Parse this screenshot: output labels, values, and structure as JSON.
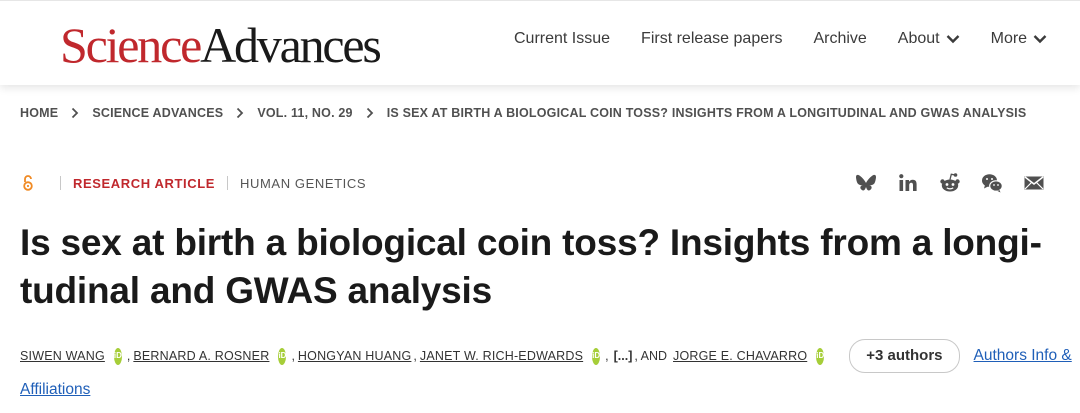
{
  "header": {
    "logo_science": "Science",
    "logo_advances": "Advances",
    "nav": [
      {
        "label": "Current Issue",
        "dropdown": false
      },
      {
        "label": "First release papers",
        "dropdown": false
      },
      {
        "label": "Archive",
        "dropdown": false
      },
      {
        "label": "About",
        "dropdown": true
      },
      {
        "label": "More",
        "dropdown": true
      }
    ]
  },
  "breadcrumb": [
    "HOME",
    "SCIENCE ADVANCES",
    "VOL. 11, NO. 29",
    "IS SEX AT BIRTH A BIOLOGICAL COIN TOSS? INSIGHTS FROM A LONGITUDINAL AND GWAS ANALYSIS"
  ],
  "article": {
    "open_access_icon": "open-access-icon",
    "type": "RESEARCH ARTICLE",
    "subject": "HUMAN GENETICS",
    "title": "Is sex at birth a biological coin toss? Insights from a longi-tudinal and GWAS analysis",
    "share_icons": [
      "bluesky-icon",
      "linkedin-icon",
      "reddit-icon",
      "wechat-icon",
      "email-icon"
    ]
  },
  "authors": {
    "list": [
      "SIWEN WANG",
      "BERNARD A. ROSNER",
      "HONGYAN HUANG",
      "JANET W. RICH-EDWARDS",
      "JORGE E. CHAVARRO"
    ],
    "orcid_label": "iD",
    "ellipsis": "[...]",
    "and_text": ", AND",
    "more_button": "+3 authors",
    "info_link_line1": "Authors Info &",
    "info_link_line2": "Affiliations"
  },
  "colors": {
    "brand_red": "#c0282d",
    "orcid_green": "#a6ce39",
    "link_blue": "#1f5fb8",
    "open_access_orange": "#f08a24"
  }
}
